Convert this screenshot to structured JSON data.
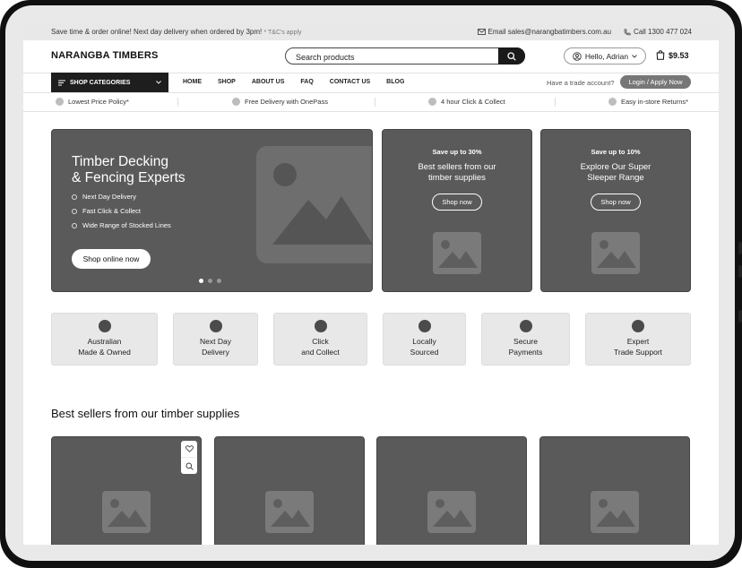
{
  "topbar": {
    "promo_text": "Save time & order online! Next day delivery when ordered by 3pm!",
    "promo_tc": "* T&C's apply",
    "email": "Email sales@narangbatimbers.com.au",
    "phone": "Call 1300 477 024"
  },
  "header": {
    "logo": "NARANGBA TIMBERS",
    "search_placeholder": "Search products",
    "account_label": "Hello, Adrian",
    "cart_total": "$9.53"
  },
  "nav": {
    "shop_categories": "SHOP CATEGORIES",
    "links": [
      "HOME",
      "SHOP",
      "ABOUT US",
      "FAQ",
      "CONTACT US",
      "BLOG"
    ],
    "trade_text": "Have a trade account?",
    "login_label": "Login / Apply Now"
  },
  "usp": [
    "Lowest Price Policy*",
    "Free Delivery with OnePass",
    "4 hour Click & Collect",
    "Easy in-store Returns*"
  ],
  "hero": {
    "title_line1": "Timber Decking",
    "title_line2": "& Fencing Experts",
    "bullets": [
      "Next Day Delivery",
      "Fast Click & Collect",
      "Wide Range of Stocked Lines"
    ],
    "cta": "Shop online now",
    "slide_count": 3,
    "active_slide": 1
  },
  "promos": [
    {
      "save": "Save up to 30%",
      "title_line1": "Best sellers from our",
      "title_line2": "timber supplies",
      "button": "Shop now"
    },
    {
      "save": "Save up to 10%",
      "title_line1": "Explore Our Super",
      "title_line2": "Sleeper Range",
      "button": "Shop now"
    }
  ],
  "features": [
    {
      "line1": "Australian",
      "line2": "Made & Owned"
    },
    {
      "line1": "Next Day",
      "line2": "Delivery"
    },
    {
      "line1": "Click",
      "line2": "and Collect"
    },
    {
      "line1": "Locally",
      "line2": "Sourced"
    },
    {
      "line1": "Secure",
      "line2": "Payments"
    },
    {
      "line1": "Expert",
      "line2": "Trade Support"
    }
  ],
  "best_sellers": {
    "title": "Best sellers from our timber supplies"
  },
  "colors": {
    "card_bg": "#5a5a5a",
    "feature_bg": "#e8e8e8",
    "dark": "#1e1e1e"
  }
}
